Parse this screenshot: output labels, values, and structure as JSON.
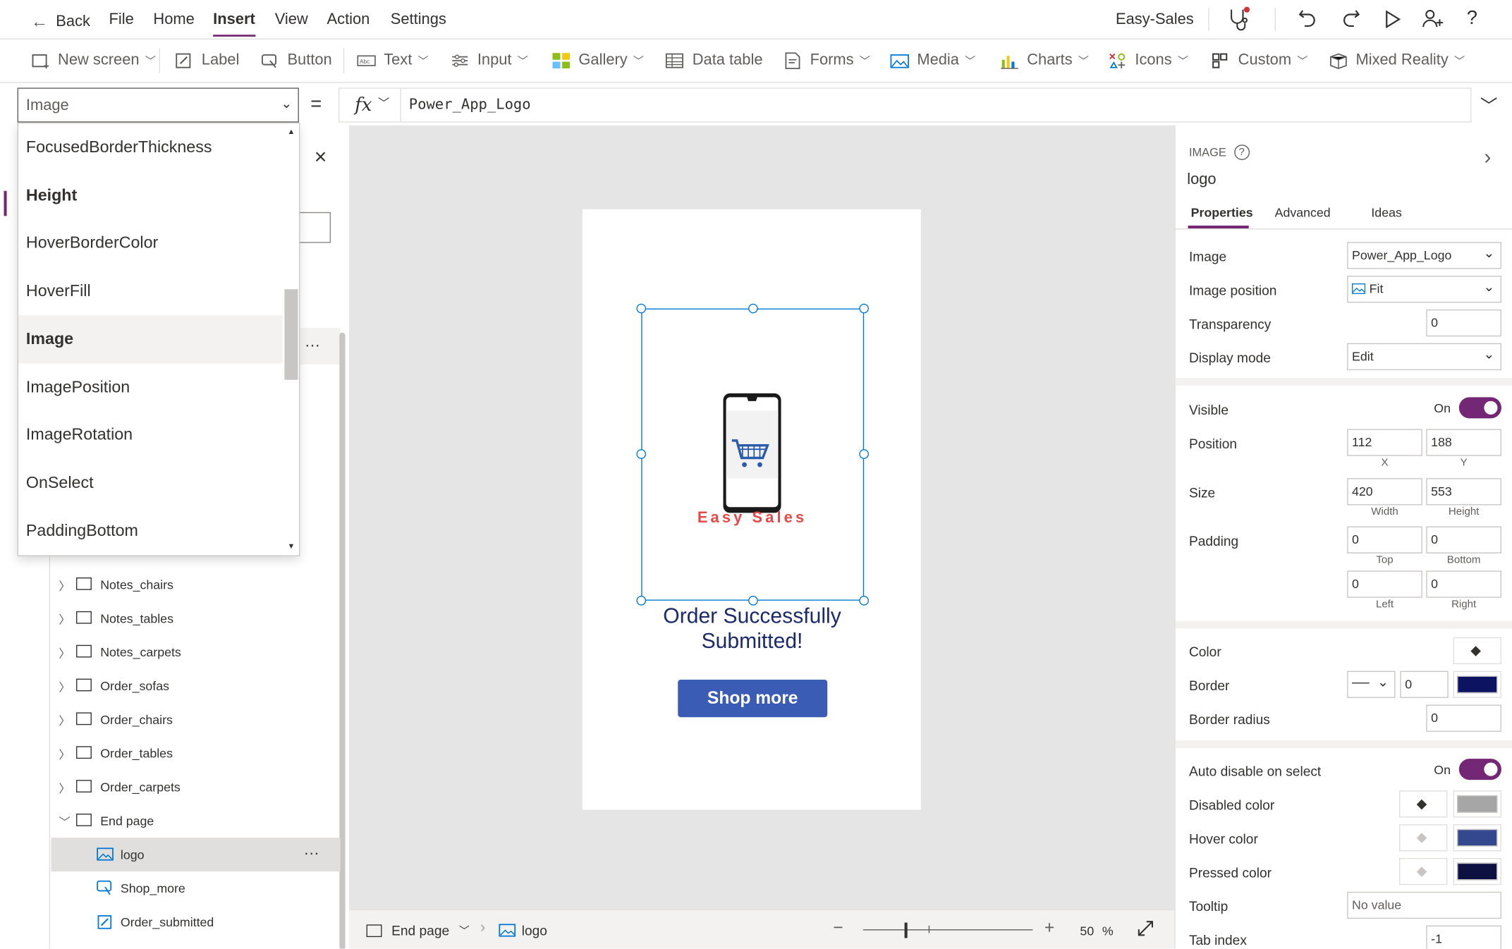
{
  "menu": {
    "back": "Back",
    "file": "File",
    "home": "Home",
    "insert": "Insert",
    "view": "View",
    "action": "Action",
    "settings": "Settings",
    "app_name": "Easy-Sales"
  },
  "toolbar": {
    "new_screen": "New screen",
    "label": "Label",
    "button": "Button",
    "text": "Text",
    "input": "Input",
    "gallery": "Gallery",
    "data_table": "Data table",
    "forms": "Forms",
    "media": "Media",
    "charts": "Charts",
    "icons": "Icons",
    "custom": "Custom",
    "mixed_reality": "Mixed Reality"
  },
  "formula": {
    "property": "Image",
    "equals": "=",
    "fx": "fx",
    "value": "Power_App_Logo"
  },
  "property_list": [
    "FocusedBorderThickness",
    "Height",
    "HoverBorderColor",
    "HoverFill",
    "Image",
    "ImagePosition",
    "ImageRotation",
    "OnSelect",
    "PaddingBottom"
  ],
  "tree": {
    "items": [
      "Notes_chairs",
      "Notes_tables",
      "Notes_carpets",
      "Order_sofas",
      "Order_chairs",
      "Order_tables",
      "Order_carpets",
      "End page"
    ],
    "children": [
      "logo",
      "Shop_more",
      "Order_submitted"
    ],
    "more": "···"
  },
  "canvas": {
    "brand_text": "Easy Sales",
    "order_text": "Order Successfully Submitted!",
    "shop_button": "Shop more"
  },
  "bottom": {
    "screen": "End page",
    "control": "logo",
    "zoom": "50",
    "zoom_unit": "%",
    "minus": "−",
    "plus": "+"
  },
  "props": {
    "type": "IMAGE",
    "name": "logo",
    "tabs": [
      "Properties",
      "Advanced",
      "Ideas"
    ],
    "image_label": "Image",
    "image_value": "Power_App_Logo",
    "image_position_label": "Image position",
    "image_position_value": "Fit",
    "transparency_label": "Transparency",
    "transparency_value": "0",
    "display_mode_label": "Display mode",
    "display_mode_value": "Edit",
    "visible_label": "Visible",
    "visible_value": "On",
    "position_label": "Position",
    "x": "112",
    "y": "188",
    "x_label": "X",
    "y_label": "Y",
    "size_label": "Size",
    "width": "420",
    "height": "553",
    "width_label": "Width",
    "height_label": "Height",
    "padding_label": "Padding",
    "pad_top": "0",
    "pad_bottom": "0",
    "pad_left": "0",
    "pad_right": "0",
    "top_label": "Top",
    "bottom_label": "Bottom",
    "left_label": "Left",
    "right_label": "Right",
    "color_label": "Color",
    "border_label": "Border",
    "border_value": "0",
    "border_radius_label": "Border radius",
    "border_radius_value": "0",
    "auto_disable_label": "Auto disable on select",
    "auto_disable_value": "On",
    "disabled_color_label": "Disabled color",
    "hover_color_label": "Hover color",
    "pressed_color_label": "Pressed color",
    "tooltip_label": "Tooltip",
    "tooltip_placeholder": "No value",
    "tab_index_label": "Tab index",
    "tab_index_value": "-1"
  },
  "colors": {
    "accent": "#742774",
    "border_color": "#0c1461",
    "disabled": "#a6a6a6",
    "hover": "#34488e",
    "pressed": "#0c1142",
    "button": "#3a5cb5"
  }
}
